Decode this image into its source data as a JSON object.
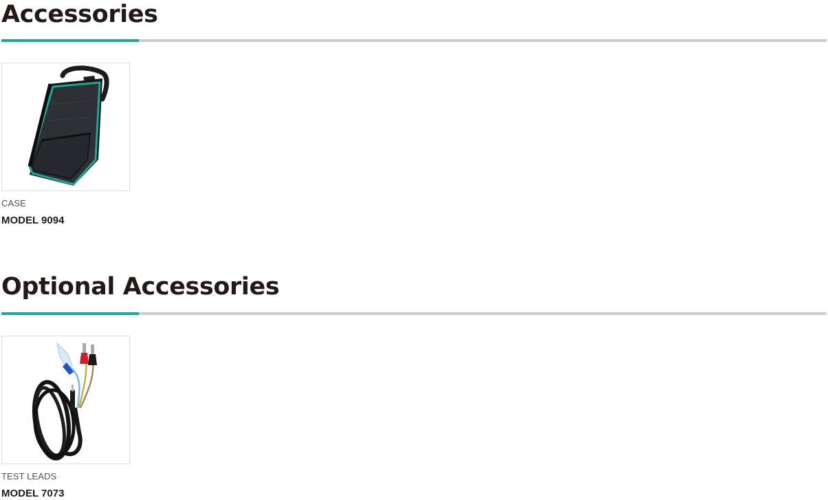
{
  "colors": {
    "accent": "#1aa898",
    "rule": "#c6cfcc",
    "heading": "#231a17"
  },
  "sections": [
    {
      "title": "Accessories",
      "items": [
        {
          "category": "CASE",
          "model": "MODEL 9094",
          "image": "carrying-case-image"
        }
      ]
    },
    {
      "title": "Optional Accessories",
      "items": [
        {
          "category": "TEST LEADS",
          "model": "MODEL 7073",
          "image": "test-leads-image"
        }
      ]
    }
  ]
}
